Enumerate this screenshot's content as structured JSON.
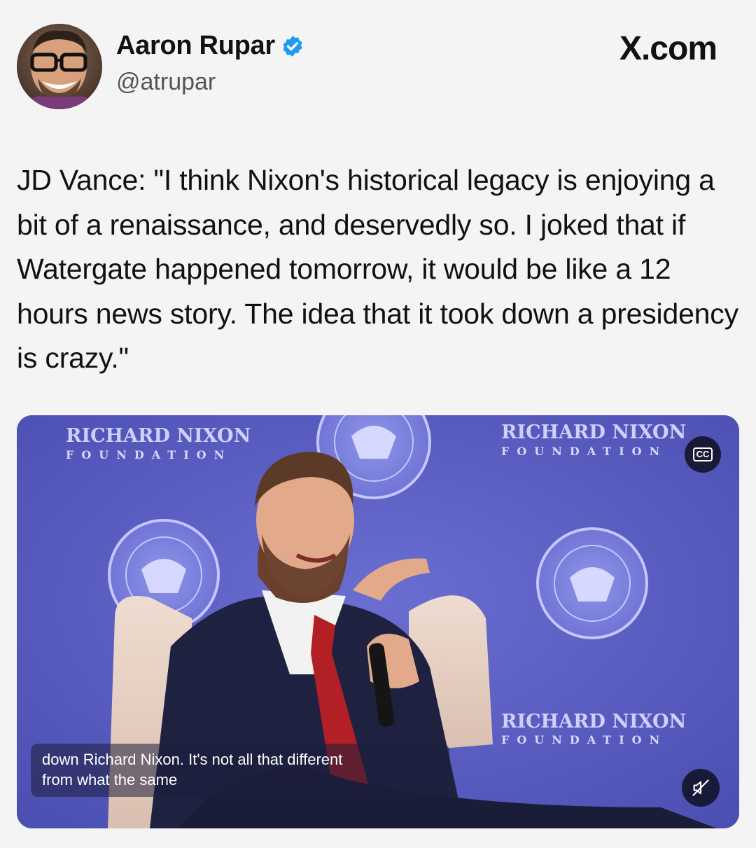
{
  "post": {
    "author_name": "Aaron Rupar",
    "handle": "@atrupar",
    "site_label": "X.com",
    "text": "JD Vance: \"I think Nixon's historical legacy is enjoying a bit of a renaissance, and deservedly so. I joked that if Watergate happened tomorrow, it would be like a 12 hours news story. The idea that it took down a presidency is crazy.\""
  },
  "video": {
    "backdrop_title": "RICHARD NIXON",
    "backdrop_subtitle": "FOUNDATION",
    "caption_line1": "down Richard Nixon. It's not all that different",
    "caption_line2": "from what the same",
    "cc_label": "CC",
    "colors": {
      "backdrop": "#5b5fc0",
      "suit": "#1e2240",
      "tie": "#b21f24",
      "chair": "#e8d2c6"
    }
  },
  "icons": {
    "verified": "verified-badge-icon",
    "cc": "closed-captions-icon",
    "mute": "muted-speaker-icon"
  }
}
